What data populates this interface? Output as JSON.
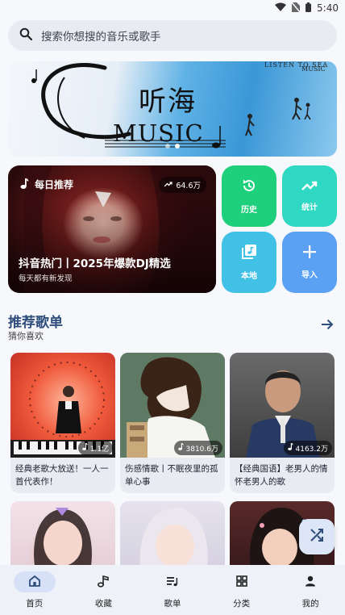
{
  "status_bar": {
    "time": "5:40"
  },
  "search": {
    "placeholder": "搜索你想搜的音乐或歌手"
  },
  "banner": {
    "title": "听海",
    "word": "MUSIC",
    "small_line1": "LISTEN TO SEA",
    "small_line2": "MUSIC",
    "dots_count": 2,
    "active_dot": 1
  },
  "daily": {
    "header": "每日推荐",
    "badge": "64.6万",
    "title": "抖音热门丨2025年爆款DJ精选",
    "subtitle": "每天都有新发现"
  },
  "tiles": [
    {
      "label": "历史",
      "icon": "history-icon"
    },
    {
      "label": "统计",
      "icon": "trending-icon"
    },
    {
      "label": "本地",
      "icon": "library-music-icon"
    },
    {
      "label": "导入",
      "icon": "plus-icon"
    }
  ],
  "section": {
    "title": "推荐歌单",
    "subtitle": "猜你喜欢"
  },
  "playlists": [
    {
      "name": "经典老歌大放送！一人一首代表作！",
      "plays": "1.1亿"
    },
    {
      "name": "伤感情歌丨不眠夜里的孤单心事",
      "plays": "3810.6万"
    },
    {
      "name": "【经典国语】老男人的情怀老男人的歌",
      "plays": "4163.2万"
    }
  ],
  "fab": {
    "icon": "shuffle-icon"
  },
  "nav": [
    {
      "label": "首页",
      "icon": "home-icon",
      "active": true
    },
    {
      "label": "收藏",
      "icon": "music-note-icon",
      "active": false
    },
    {
      "label": "歌单",
      "icon": "playlist-icon",
      "active": false
    },
    {
      "label": "分类",
      "icon": "grid-icon",
      "active": false
    },
    {
      "label": "我的",
      "icon": "person-icon",
      "active": false
    }
  ],
  "colors": {
    "accent": "#2f4e7c",
    "history": "#1ecf7b",
    "stats": "#2ed8c2",
    "local": "#42c1e6",
    "import": "#5aa0f3"
  }
}
